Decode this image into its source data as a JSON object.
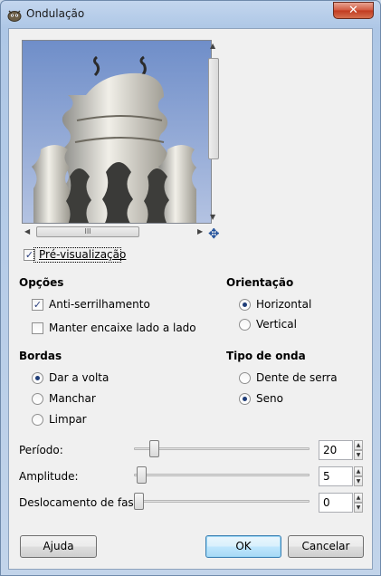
{
  "window": {
    "title": "Ondulação",
    "close_glyph": "✕"
  },
  "preview": {
    "checkbox_label": "Pré-visualização",
    "checked": true,
    "scroll_grip": "III",
    "nav_icon": "move-icon"
  },
  "options": {
    "heading": "Opções",
    "antialias_label": "Anti-serrilhamento",
    "antialias_checked": true,
    "retain_tile_label": "Manter encaixe lado a lado",
    "retain_tile_checked": false
  },
  "orientation": {
    "heading": "Orientação",
    "horizontal_label": "Horizontal",
    "vertical_label": "Vertical",
    "selected": "horizontal"
  },
  "edges": {
    "heading": "Bordas",
    "wrap_label": "Dar a volta",
    "smear_label": "Manchar",
    "blank_label": "Limpar",
    "selected": "wrap"
  },
  "wave_type": {
    "heading": "Tipo de onda",
    "sawtooth_label": "Dente de serra",
    "sine_label": "Seno",
    "selected": "sine"
  },
  "sliders": {
    "period": {
      "label": "Período:",
      "value": "20"
    },
    "amplitude": {
      "label": "Amplitude:",
      "value": "5"
    },
    "phase": {
      "label": "Deslocamento de fase:",
      "value": "0"
    }
  },
  "buttons": {
    "help": "Ajuda",
    "ok": "OK",
    "cancel": "Cancelar"
  },
  "colors": {
    "accent": "#1f3d78",
    "close_red": "#c13a1f",
    "sky": "#8aa3d2"
  }
}
